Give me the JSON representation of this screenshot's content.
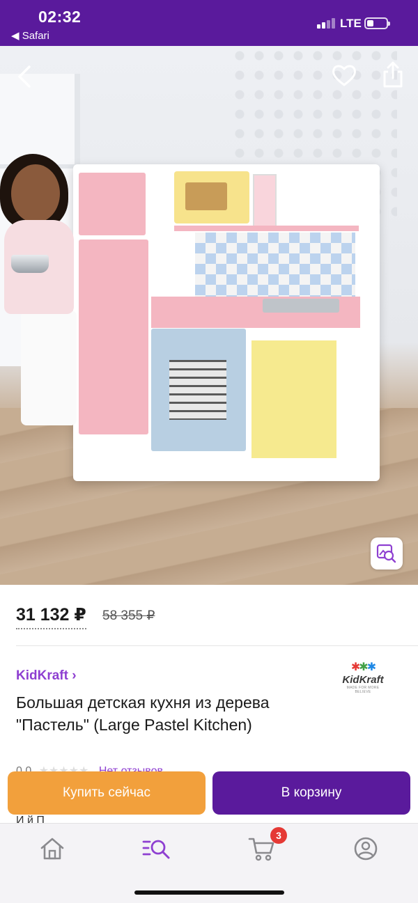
{
  "status_bar": {
    "time": "02:32",
    "back_app": "◀ Safari",
    "network": "LTE",
    "battery_level": 0.35
  },
  "product": {
    "price_current": "31 132 ₽",
    "price_old": "58 355 ₽",
    "brand": "KidKraft ›",
    "brand_logo_text": "KidKraft",
    "brand_logo_tagline": "MADE FOR MORE BELIEVE",
    "title": "Большая детская кухня из дерева \"Пастель\" (Large Pastel Kitchen)",
    "rating": "0,0",
    "rating_stars": "★★★★★",
    "reviews": "Нет отзывов"
  },
  "actions": {
    "buy_now": "Купить сейчас",
    "add_to_cart": "В корзину"
  },
  "peek_text": "И                                              й                  П",
  "tabbar": {
    "cart_count": "3",
    "icons": [
      "home-icon",
      "catalog-search-icon",
      "cart-icon",
      "profile-icon"
    ],
    "accent": "#8e3fd1"
  },
  "colors": {
    "brand_purple": "#5a1a9c",
    "accent_purple": "#8e3fd1",
    "buy_orange": "#f2a03c"
  }
}
